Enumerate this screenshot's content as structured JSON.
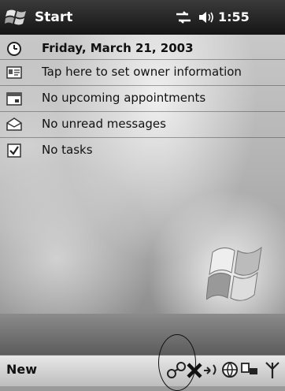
{
  "titlebar": {
    "start_label": "Start",
    "clock": "1:55",
    "icons": [
      "windows-start-icon",
      "connectivity-icon",
      "speaker-icon"
    ]
  },
  "today": {
    "date": "Friday, March 21, 2003",
    "owner": "Tap here to set owner information",
    "appointments": "No upcoming appointments",
    "messages": "No unread messages",
    "tasks": "No tasks"
  },
  "menubar": {
    "new_label": "New",
    "tray_icons": [
      "wireless-link-icon",
      "error-x-icon",
      "network-icon",
      "globe-icon",
      "device-icon",
      "antenna-icon"
    ]
  },
  "colors": {
    "titlebar": "#1e1e1e",
    "menubar": "#cfcfcf"
  }
}
